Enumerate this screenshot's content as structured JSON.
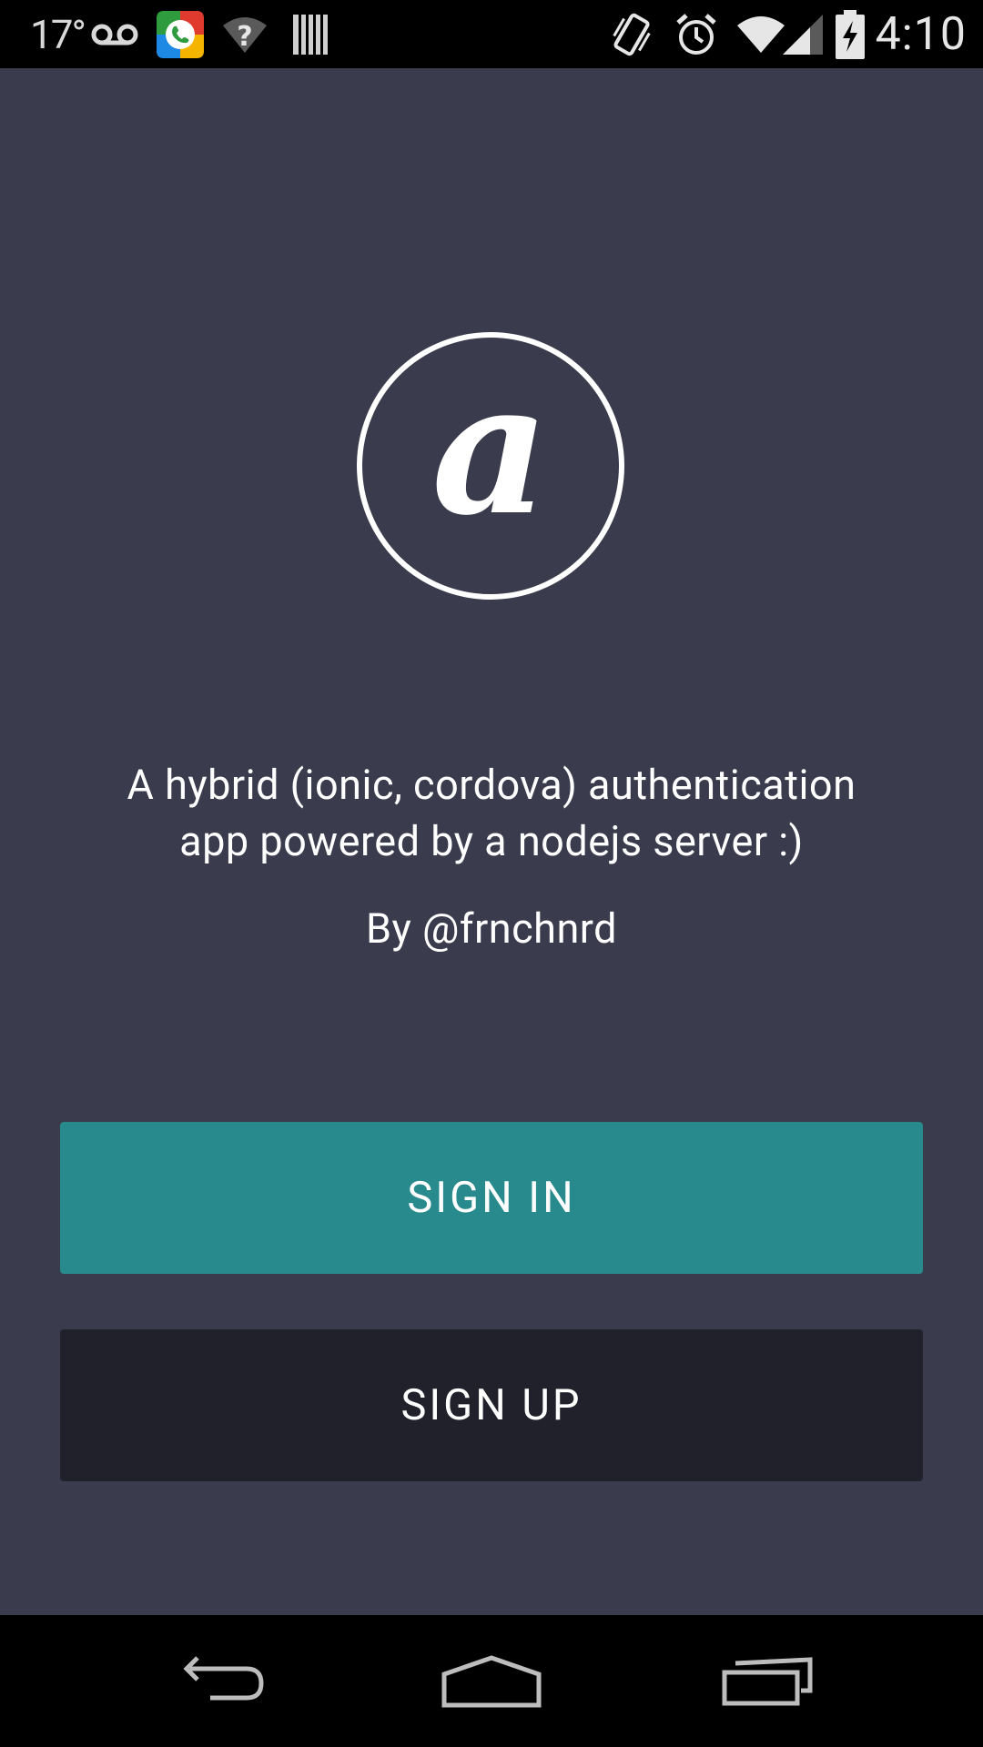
{
  "status_bar": {
    "temperature": "17°",
    "time": "4:10",
    "icons": [
      "voicemail-icon",
      "hangouts-dialer-icon",
      "wifi-unknown-icon",
      "barcode-icon",
      "vibrate-icon",
      "alarm-icon",
      "wifi-icon",
      "cell-signal-icon",
      "battery-charging-icon"
    ]
  },
  "main": {
    "logo_icon": "at-sign-icon",
    "description_line1": "A hybrid (ionic, cordova) authentication",
    "description_line2": "app powered by a nodejs server :)",
    "byline": "By @frnchnrd"
  },
  "buttons": {
    "sign_in": "SIGN IN",
    "sign_up": "SIGN UP"
  },
  "nav_bar": {
    "icons": [
      "back-icon",
      "home-icon",
      "recent-apps-icon"
    ]
  },
  "colors": {
    "background": "#3a3b4c",
    "sign_in": "#288a8d",
    "sign_up": "#20212b",
    "system_bars": "#000000"
  }
}
